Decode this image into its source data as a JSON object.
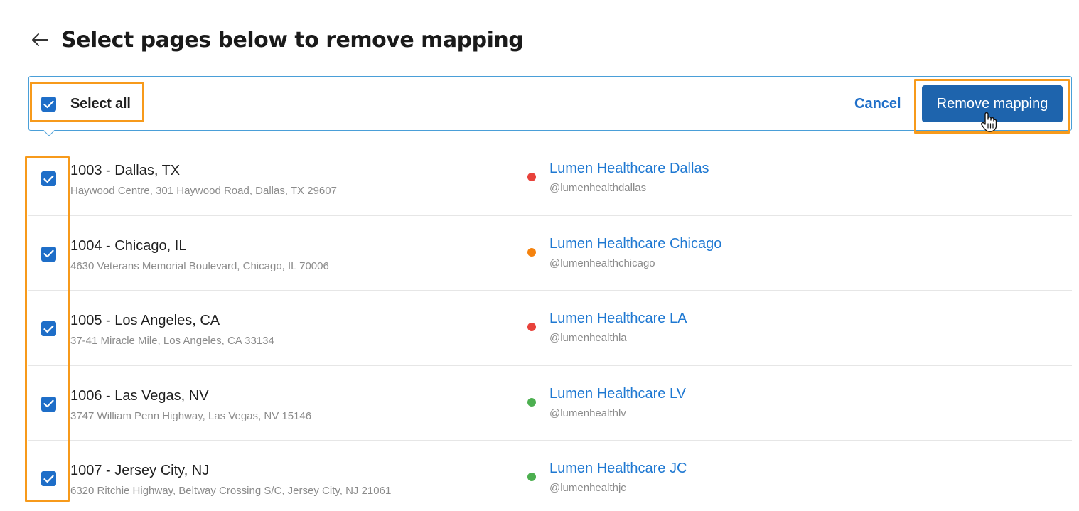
{
  "header": {
    "title": "Select pages below to remove mapping",
    "back_icon": "arrow-left-icon"
  },
  "select_bar": {
    "select_all_label": "Select all",
    "select_all_checked": true,
    "cancel_label": "Cancel",
    "remove_label": "Remove mapping"
  },
  "colors": {
    "accent": "#1e6ec8",
    "primary_button": "#1e64ad",
    "link": "#1e78d2",
    "highlight": "#f79a1b",
    "status_red": "#e8423b",
    "status_orange": "#f5820d",
    "status_green": "#4caf50"
  },
  "rows": [
    {
      "location": "1003 - Dallas, TX",
      "address": "Haywood Centre, 301 Haywood Road, Dallas, TX 29607",
      "page_name": "Lumen Healthcare Dallas",
      "handle": "@lumenhealthdallas",
      "status_color": "#e8423b",
      "checked": true
    },
    {
      "location": "1004 - Chicago, IL",
      "address": "4630 Veterans Memorial Boulevard, Chicago, IL 70006",
      "page_name": "Lumen Healthcare Chicago",
      "handle": "@lumenhealthchicago",
      "status_color": "#f5820d",
      "checked": true
    },
    {
      "location": "1005 - Los Angeles, CA",
      "address": "37-41 Miracle Mile, Los Angeles, CA 33134",
      "page_name": "Lumen Healthcare LA",
      "handle": "@lumenhealthla",
      "status_color": "#e8423b",
      "checked": true
    },
    {
      "location": "1006 - Las Vegas, NV",
      "address": "3747 William Penn Highway, Las Vegas, NV 15146",
      "page_name": "Lumen Healthcare LV",
      "handle": "@lumenhealthlv",
      "status_color": "#4caf50",
      "checked": true
    },
    {
      "location": "1007 - Jersey City, NJ",
      "address": "6320 Ritchie Highway, Beltway Crossing S/C, Jersey City, NJ 21061",
      "page_name": "Lumen Healthcare JC",
      "handle": "@lumenhealthjc",
      "status_color": "#4caf50",
      "checked": true
    }
  ]
}
